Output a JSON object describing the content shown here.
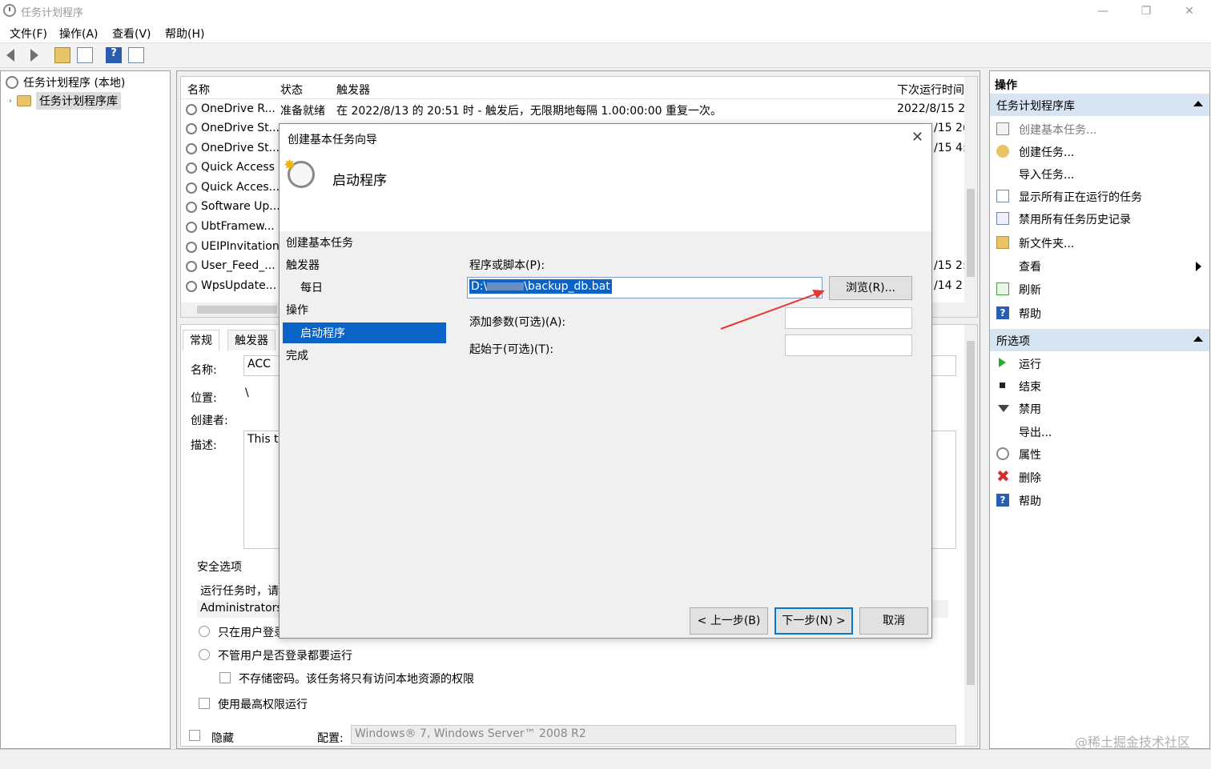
{
  "window": {
    "title": "任务计划程序",
    "minimize": "—",
    "maximize": "❐",
    "close": "✕"
  },
  "menu": [
    "文件(F)",
    "操作(A)",
    "查看(V)",
    "帮助(H)"
  ],
  "tree": {
    "root": "任务计划程序 (本地)",
    "library": "任务计划程序库"
  },
  "list": {
    "headers": {
      "name": "名称",
      "status": "状态",
      "trigger": "触发器",
      "next_run": "下次运行时间"
    },
    "first_row": {
      "name": "OneDrive R...",
      "status": "准备就绪",
      "trigger": "在 2022/8/13 的 20:51 时 - 触发后，无限期地每隔 1.00:00:00 重复一次。",
      "next_run": "2022/8/15 2("
    },
    "rows": [
      "OneDrive St...",
      "OneDrive St...",
      "Quick Access",
      "Quick Acces...",
      "Software Up...",
      "UbtFramew...",
      "UEIPInvitation",
      "User_Feed_...",
      "WpsUpdate..."
    ],
    "next_run_partials": [
      "/15 2(",
      "/15 4:",
      "/15 2:",
      "/14 2"
    ]
  },
  "detail": {
    "tabs": [
      "常规",
      "触发器"
    ],
    "name_label": "名称:",
    "name_value": "ACC",
    "location_label": "位置:",
    "location_value": "\\",
    "author_label": "创建者:",
    "desc_label": "描述:",
    "desc_value": "This ta",
    "security_title": "安全选项",
    "run_as_text": "运行任务时，请",
    "user_value": "Administrators",
    "radio1": "只在用户登录",
    "radio2": "不管用户是否登录都要运行",
    "check_nopwd": "不存储密码。该任务将只有访问本地资源的权限",
    "check_highest": "使用最高权限运行",
    "hidden_label": "隐藏",
    "config_label": "配置:",
    "config_value": "Windows® 7, Windows Server™ 2008 R2"
  },
  "actions": {
    "header": "操作",
    "section1": "任务计划程序库",
    "items1": [
      "创建基本任务...",
      "创建任务...",
      "导入任务...",
      "显示所有正在运行的任务",
      "禁用所有任务历史记录",
      "新文件夹...",
      "查看",
      "刷新",
      "帮助"
    ],
    "section2": "所选项",
    "items2": [
      "运行",
      "结束",
      "禁用",
      "导出...",
      "属性",
      "删除",
      "帮助"
    ]
  },
  "dialog": {
    "title": "创建基本任务向导",
    "close": "✕",
    "heading": "启动程序",
    "steps": [
      "创建基本任务",
      "触发器",
      "每日",
      "操作",
      "启动程序",
      "完成"
    ],
    "program_label": "程序或脚本(P):",
    "program_value_prefix": "D:\\",
    "program_value_suffix": "\\backup_db.bat",
    "browse": "浏览(R)...",
    "args_label": "添加参数(可选)(A):",
    "start_in_label": "起始于(可选)(T):",
    "back": "< 上一步(B)",
    "next": "下一步(N) >",
    "cancel": "取消"
  },
  "watermark": "@稀土掘金技术社区",
  "colors": {
    "selection": "#0a64c8",
    "section_bg": "#d7e4f2",
    "arrow": "#e53935"
  }
}
